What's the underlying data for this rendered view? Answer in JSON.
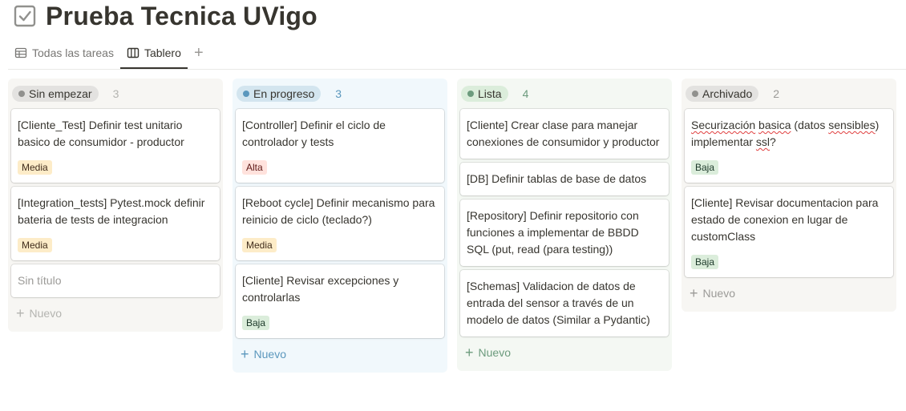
{
  "page": {
    "title": "Prueba Tecnica UVigo",
    "icon": "checkbox-icon"
  },
  "tabs": [
    {
      "label": "Todas las tareas",
      "icon": "table-icon",
      "active": false
    },
    {
      "label": "Tablero",
      "icon": "board-icon",
      "active": true
    }
  ],
  "tab_add_label": "+",
  "colors": {
    "col_gray_bg": "#f7f6f3",
    "col_blue_bg": "#f1f8fc",
    "col_green_bg": "#f4f8f3",
    "tag_media_bg": "#fdecc8",
    "tag_media_fg": "#402c1b",
    "tag_alta_bg": "#ffe2dd",
    "tag_alta_fg": "#5d1715",
    "tag_baja_bg": "#dbeddb",
    "tag_baja_fg": "#1c3829"
  },
  "columns": [
    {
      "status": "Sin empezar",
      "count": "3",
      "new_label": "Nuevo",
      "cards": [
        {
          "title": "[Cliente_Test] Definir test unitario basico de consumidor - productor",
          "tag": "Media"
        },
        {
          "title": "[Integration_tests] Pytest.mock definir bateria de tests de integracion",
          "tag": "Media"
        },
        {
          "title": "Sin título",
          "tag": ""
        }
      ]
    },
    {
      "status": "En progreso",
      "count": "3",
      "new_label": "Nuevo",
      "cards": [
        {
          "title": "[Controller] Definir el ciclo de controlador y tests",
          "tag": "Alta"
        },
        {
          "title": "[Reboot cycle] Definir mecanismo para reinicio de ciclo (teclado?)",
          "tag": "Media"
        },
        {
          "title": "[Cliente] Revisar excepciones y controlarlas",
          "tag": "Baja"
        }
      ]
    },
    {
      "status": "Lista",
      "count": "4",
      "new_label": "Nuevo",
      "cards": [
        {
          "title": "[Cliente] Crear clase para manejar conexiones de consumidor y productor",
          "tag": ""
        },
        {
          "title": "[DB] Definir tablas de base de datos",
          "tag": ""
        },
        {
          "title": "[Repository] Definir repositorio con funciones a implementar de BBDD SQL (put, read (para testing))",
          "tag": ""
        },
        {
          "title": "[Schemas] Validacion de datos de entrada del sensor a través de un modelo de datos (Similar a Pydantic)",
          "tag": ""
        }
      ]
    },
    {
      "status": "Archivado",
      "count": "2",
      "new_label": "Nuevo",
      "cards": [
        {
          "title_parts": [
            "Securización",
            " ",
            "basica",
            " (datos ",
            "sensibles",
            ") implementar ",
            "ssl",
            "?"
          ],
          "tag": "Baja"
        },
        {
          "title": "[Cliente] Revisar documentacion para estado de conexion en lugar de customClass",
          "tag": "Baja"
        }
      ]
    }
  ]
}
